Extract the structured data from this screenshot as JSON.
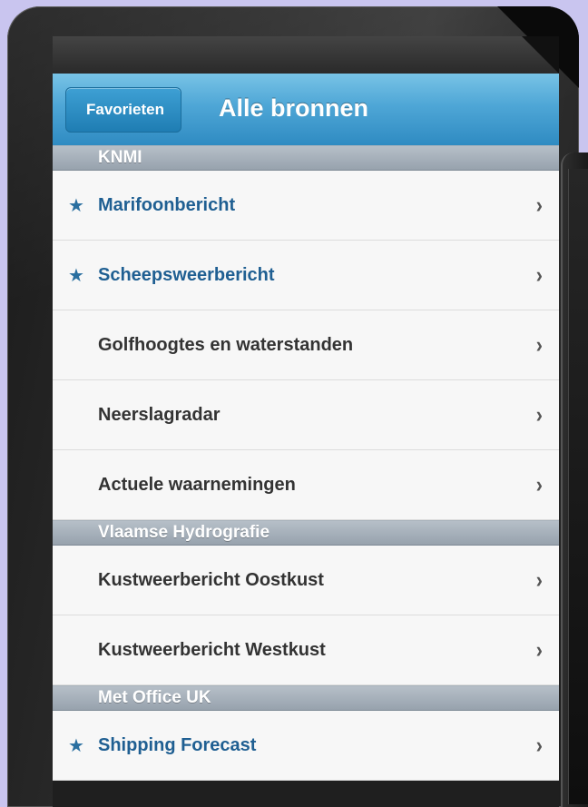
{
  "navbar": {
    "back_label": "Favorieten",
    "title": "Alle bronnen"
  },
  "sections": [
    {
      "title": "KNMI",
      "items": [
        {
          "label": "Marifoonbericht",
          "favorite": true
        },
        {
          "label": "Scheepsweerbericht",
          "favorite": true
        },
        {
          "label": "Golfhoogtes en waterstanden",
          "favorite": false
        },
        {
          "label": "Neerslagradar",
          "favorite": false
        },
        {
          "label": "Actuele waarnemingen",
          "favorite": false
        }
      ]
    },
    {
      "title": "Vlaamse Hydrografie",
      "items": [
        {
          "label": "Kustweerbericht Oostkust",
          "favorite": false
        },
        {
          "label": "Kustweerbericht Westkust",
          "favorite": false
        }
      ]
    },
    {
      "title": "Met Office UK",
      "items": [
        {
          "label": "Shipping Forecast",
          "favorite": true
        }
      ]
    }
  ],
  "icons": {
    "favorite": "star-icon",
    "disclosure": "chevron-right-icon"
  },
  "colors": {
    "navbar": "#4ea6d6",
    "favorite_text": "#1f5f92",
    "section_header": "#a3adb7",
    "background": "#c9c5ef"
  }
}
